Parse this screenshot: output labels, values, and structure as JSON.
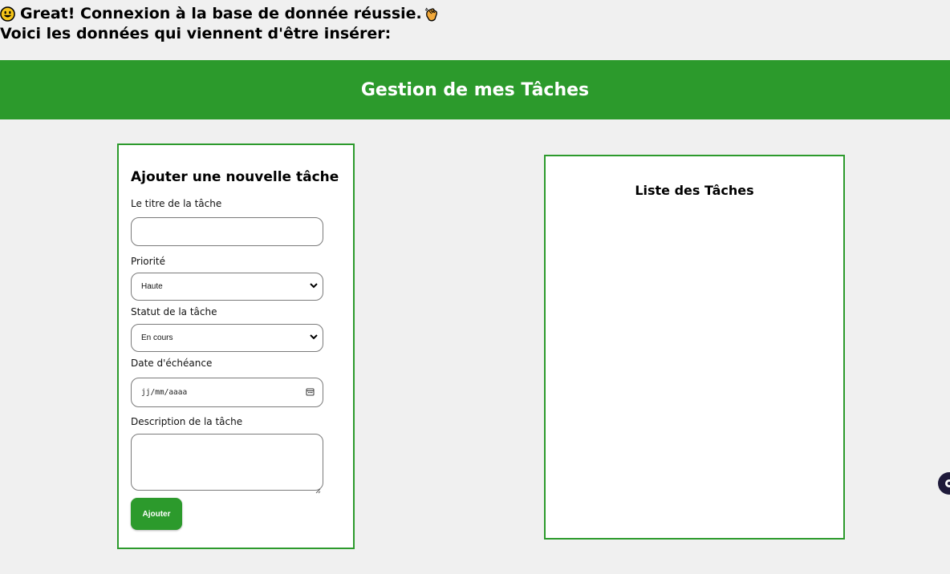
{
  "message": {
    "line1": "Great! Connexion à la base de donnée réussie.",
    "line2": "Voici les données qui viennent d'être insérer:",
    "icons": [
      "smiley-icon",
      "clapping-hands-icon"
    ]
  },
  "header": {
    "title": "Gestion de mes Tâches"
  },
  "form": {
    "title": "Ajouter une nouvelle tâche",
    "title_label": "Le titre de la tâche",
    "title_value": "",
    "priority_label": "Priorité",
    "priority_value": "Haute",
    "status_label": "Statut de la tâche",
    "status_value": "En cours",
    "due_label": "Date d'échéance",
    "due_placeholder": "jj/mm/aaaa",
    "description_label": "Description de la tâche",
    "description_value": "",
    "submit_label": "Ajouter"
  },
  "list": {
    "title": "Liste des Tâches",
    "items": []
  },
  "colors": {
    "accent": "#2c9a2c",
    "background": "#f0f0f0",
    "card": "#ffffff"
  }
}
